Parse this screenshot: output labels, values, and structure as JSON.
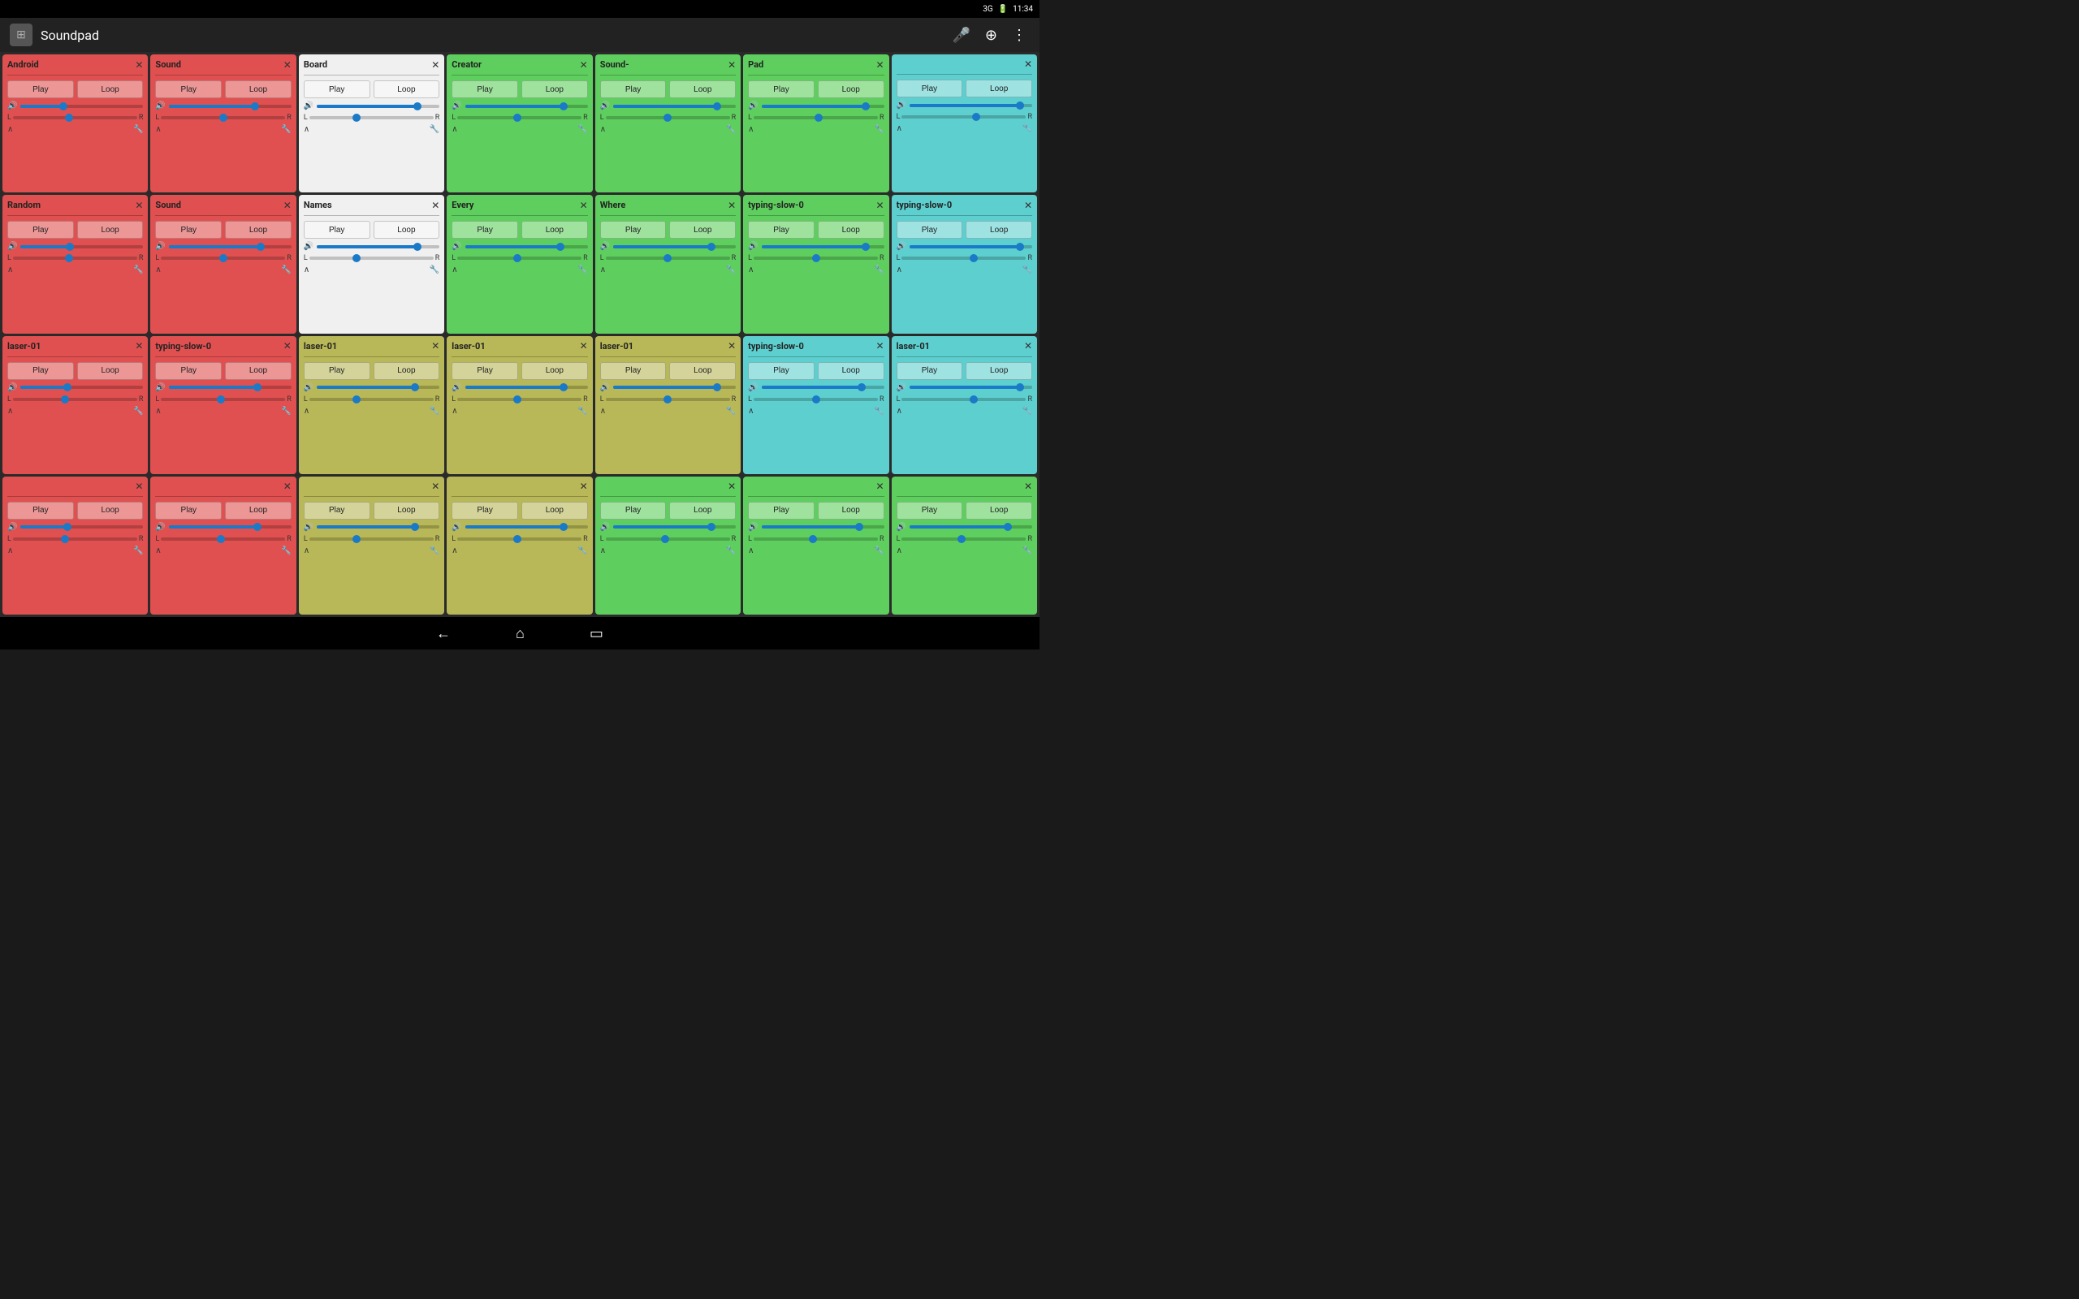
{
  "statusBar": {
    "network": "3G",
    "signal": "▪▪▪",
    "battery": "🔋",
    "time": "11:34"
  },
  "appBar": {
    "title": "Soundpad",
    "micIcon": "🎤",
    "addIcon": "⊕",
    "menuIcon": "⋮"
  },
  "cards": [
    {
      "id": 1,
      "title": "Android",
      "bg": "red",
      "volFill": 35,
      "volPos": 35,
      "panPos": 45,
      "row": 1,
      "col": 1
    },
    {
      "id": 2,
      "title": "Sound",
      "bg": "red",
      "volFill": 70,
      "volPos": 70,
      "panPos": 50,
      "row": 1,
      "col": 2
    },
    {
      "id": 3,
      "title": "Board",
      "bg": "white",
      "volFill": 82,
      "volPos": 82,
      "panPos": 38,
      "row": 1,
      "col": 3
    },
    {
      "id": 4,
      "title": "Creator",
      "bg": "green",
      "volFill": 80,
      "volPos": 80,
      "panPos": 48,
      "row": 1,
      "col": 4
    },
    {
      "id": 5,
      "title": "Sound-",
      "bg": "green",
      "volFill": 85,
      "volPos": 85,
      "panPos": 50,
      "row": 1,
      "col": 5
    },
    {
      "id": 6,
      "title": "Pad",
      "bg": "green",
      "volFill": 85,
      "volPos": 85,
      "panPos": 52,
      "row": 1,
      "col": 6
    },
    {
      "id": 7,
      "title": "",
      "bg": "cyan",
      "volFill": 90,
      "volPos": 90,
      "panPos": 60,
      "row": 1,
      "col": 7
    },
    {
      "id": 8,
      "title": "Random",
      "bg": "red",
      "volFill": 40,
      "volPos": 40,
      "panPos": 45,
      "row": 2,
      "col": 1
    },
    {
      "id": 9,
      "title": "Sound",
      "bg": "red",
      "volFill": 75,
      "volPos": 75,
      "panPos": 50,
      "row": 2,
      "col": 2
    },
    {
      "id": 10,
      "title": "Names",
      "bg": "white",
      "volFill": 82,
      "volPos": 82,
      "panPos": 38,
      "row": 2,
      "col": 3
    },
    {
      "id": 11,
      "title": "Every",
      "bg": "green",
      "volFill": 78,
      "volPos": 78,
      "panPos": 48,
      "row": 2,
      "col": 4
    },
    {
      "id": 12,
      "title": "Where",
      "bg": "green",
      "volFill": 80,
      "volPos": 80,
      "panPos": 50,
      "row": 2,
      "col": 5
    },
    {
      "id": 13,
      "title": "typing-slow-0",
      "bg": "green",
      "volFill": 85,
      "volPos": 85,
      "panPos": 50,
      "row": 2,
      "col": 6
    },
    {
      "id": 14,
      "title": "typing-slow-0",
      "bg": "cyan",
      "volFill": 90,
      "volPos": 90,
      "panPos": 58,
      "row": 2,
      "col": 7
    },
    {
      "id": 15,
      "title": "laser-01",
      "bg": "red",
      "volFill": 38,
      "volPos": 38,
      "panPos": 42,
      "row": 3,
      "col": 1
    },
    {
      "id": 16,
      "title": "typing-slow-0",
      "bg": "red",
      "volFill": 72,
      "volPos": 72,
      "panPos": 48,
      "row": 3,
      "col": 2
    },
    {
      "id": 17,
      "title": "laser-01",
      "bg": "olive",
      "volFill": 80,
      "volPos": 80,
      "panPos": 38,
      "row": 3,
      "col": 3
    },
    {
      "id": 18,
      "title": "laser-01",
      "bg": "olive",
      "volFill": 80,
      "volPos": 80,
      "panPos": 48,
      "row": 3,
      "col": 4
    },
    {
      "id": 19,
      "title": "laser-01",
      "bg": "olive",
      "volFill": 85,
      "volPos": 85,
      "panPos": 50,
      "row": 3,
      "col": 5
    },
    {
      "id": 20,
      "title": "typing-slow-0",
      "bg": "cyan",
      "volFill": 82,
      "volPos": 82,
      "panPos": 50,
      "row": 3,
      "col": 6
    },
    {
      "id": 21,
      "title": "laser-01",
      "bg": "cyan",
      "volFill": 90,
      "volPos": 90,
      "panPos": 58,
      "row": 3,
      "col": 7
    },
    {
      "id": 22,
      "title": "",
      "bg": "red",
      "volFill": 38,
      "volPos": 38,
      "panPos": 42,
      "row": 4,
      "col": 1
    },
    {
      "id": 23,
      "title": "",
      "bg": "red",
      "volFill": 72,
      "volPos": 72,
      "panPos": 48,
      "row": 4,
      "col": 2
    },
    {
      "id": 24,
      "title": "",
      "bg": "olive",
      "volFill": 80,
      "volPos": 80,
      "panPos": 38,
      "row": 4,
      "col": 3
    },
    {
      "id": 25,
      "title": "",
      "bg": "olive",
      "volFill": 80,
      "volPos": 80,
      "panPos": 48,
      "row": 4,
      "col": 4
    },
    {
      "id": 26,
      "title": "",
      "bg": "green",
      "volFill": 80,
      "volPos": 80,
      "panPos": 48,
      "row": 4,
      "col": 5
    },
    {
      "id": 27,
      "title": "",
      "bg": "green",
      "volFill": 80,
      "volPos": 80,
      "panPos": 48,
      "row": 4,
      "col": 6
    },
    {
      "id": 28,
      "title": "",
      "bg": "green",
      "volFill": 80,
      "volPos": 80,
      "panPos": 48,
      "row": 4,
      "col": 7
    }
  ],
  "buttons": {
    "play": "Play",
    "loop": "Loop"
  },
  "panLabels": {
    "left": "L",
    "right": "R"
  },
  "nav": {
    "back": "←",
    "home": "⌂",
    "recent": "▭"
  }
}
